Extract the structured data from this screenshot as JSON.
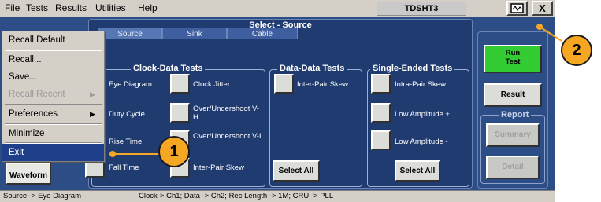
{
  "menubar": {
    "items": [
      "File",
      "Tests",
      "Results",
      "Utilities",
      "Help"
    ]
  },
  "app_title": "TDSHT3",
  "window_buttons": {
    "close": "X"
  },
  "main_panel": {
    "title": "Select - Source",
    "tabs": [
      "Source",
      "Sink",
      "Cable"
    ],
    "groups": {
      "clock_data": {
        "title": "Clock-Data Tests",
        "left_items": [
          "Eye Diagram",
          "Duty Cycle",
          "Rise Time",
          "Fall Time"
        ],
        "right_items": [
          "Clock Jitter",
          "Over/Undershoot V-H",
          "Over/Undershoot V-L",
          "Inter-Pair Skew"
        ]
      },
      "data_data": {
        "title": "Data-Data Tests",
        "items": [
          "Inter-Pair Skew"
        ],
        "select_all": "Select All"
      },
      "single_ended": {
        "title": "Single-Ended Tests",
        "items": [
          "Intra-Pair Skew",
          "Low Amplitude +",
          "Low Amplitude -"
        ],
        "select_all": "Select All"
      }
    }
  },
  "side_panel": {
    "run_test": "Run Test",
    "result": "Result",
    "report_title": "Report",
    "summary": "Summary",
    "detail": "Detail"
  },
  "waveform_button": "Waveform",
  "file_menu": {
    "items": [
      "Recall Default",
      "Recall...",
      "Save...",
      "Recall Recent",
      "Preferences",
      "Minimize",
      "Exit"
    ]
  },
  "status_bar": {
    "left": "Source -> Eye Diagram",
    "right": "Clock-> Ch1; Data -> Ch2; Rec Length -> 1M; CRU -> PLL"
  },
  "callouts": [
    "1",
    "2"
  ],
  "colors": {
    "run_test": "#33cc33",
    "callout": "#f5a623",
    "panel": "#1f3b70",
    "highlight": "#1f3f8a"
  }
}
